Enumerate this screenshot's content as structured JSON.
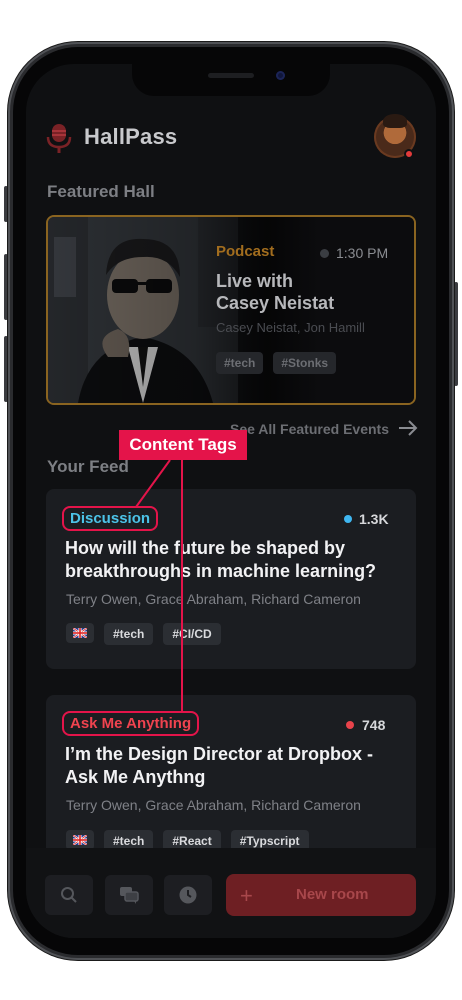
{
  "app": {
    "title": "HallPass"
  },
  "header": {
    "logo_icon": "microphone-icon",
    "avatar_status_color": "#e23b3b"
  },
  "featured": {
    "section_title": "Featured Hall",
    "category": "Podcast",
    "time": "1:30 PM",
    "title_line1": "Live with",
    "title_line2": "Casey Neistat",
    "hosts": "Casey Neistat, Jon Hamill",
    "tags": [
      "#tech",
      "#Stonks"
    ],
    "accent_color": "#a26d1e"
  },
  "see_all": {
    "label": "See All Featured Events",
    "icon": "arrow-right-icon"
  },
  "feed": {
    "section_title": "Your Feed",
    "cards": [
      {
        "badge": "Discussion",
        "badge_color": "#4cc3e8",
        "listeners": "1.3K",
        "listener_dot_color": "#3fb6f0",
        "title_line1": "How will the future be shaped by",
        "title_line2": "breakthroughs in machine learning?",
        "hosts": "Terry Owen, Grace Abraham, Richard Cameron",
        "flag": "uk-flag-icon",
        "tags": [
          "#tech",
          "#CI/CD"
        ]
      },
      {
        "badge": "Ask Me Anything",
        "badge_color": "#f0434f",
        "listeners": "748",
        "listener_dot_color": "#e8434b",
        "title_line1": "I’m the Design Director at Dropbox -",
        "title_line2": "Ask Me Anythng",
        "hosts": "Terry Owen, Grace Abraham, Richard Cameron",
        "flag": "uk-flag-icon",
        "tags": [
          "#tech",
          "#React",
          "#Typscript"
        ]
      }
    ]
  },
  "bottom_nav": {
    "items": [
      "search-icon",
      "chat-icon",
      "clock-icon"
    ],
    "new_room_label": "New room",
    "new_room_icon": "plus-icon"
  },
  "annotation": {
    "label": "Content Tags",
    "color": "#e4144a"
  }
}
